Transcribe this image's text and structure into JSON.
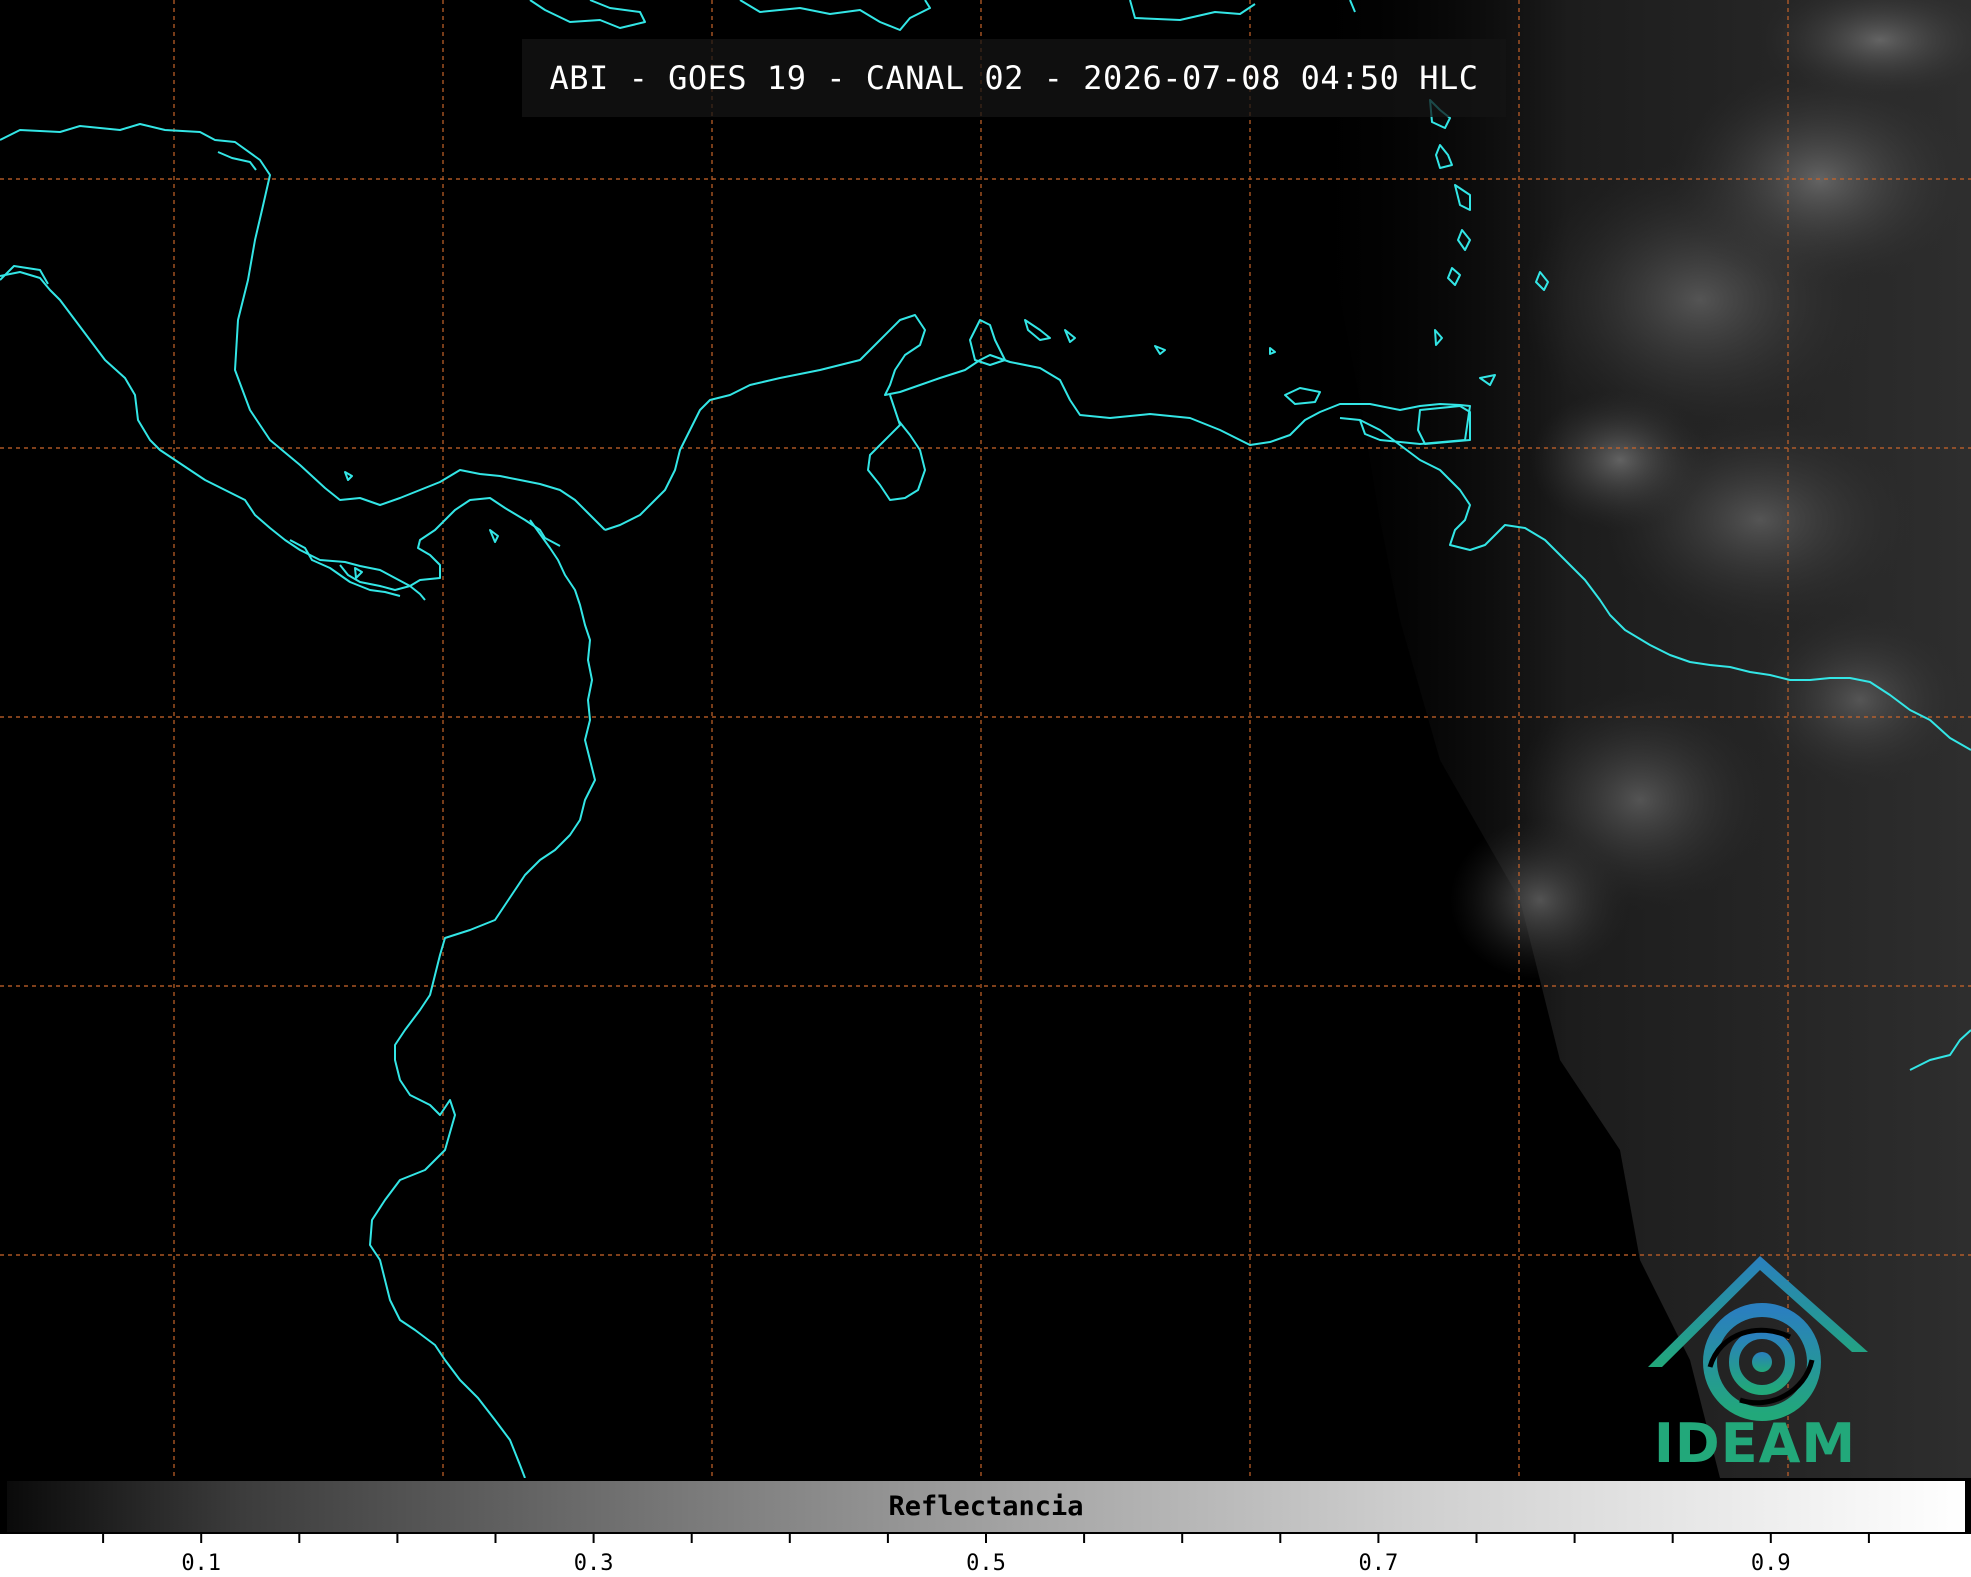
{
  "map": {
    "title": "ABI - GOES 19 - CANAL 02 - 2026-07-08 04:50 HLC",
    "coastline_color": "#33e6e6",
    "gridline_color": "#c8642a",
    "gridline_style": "dashed",
    "background": "night (black) with dim grey cloud field on the eastern side"
  },
  "logo": {
    "text": "IDEAM",
    "colors": [
      "#2a7fbf",
      "#22a87a"
    ]
  },
  "colorbar": {
    "label": "Reflectancia",
    "colormap": "greyscale",
    "range": [
      0.0,
      1.0
    ],
    "tick_labels": [
      "0.1",
      "0.3",
      "0.5",
      "0.7",
      "0.9"
    ],
    "minor_tick_step": 0.05
  }
}
